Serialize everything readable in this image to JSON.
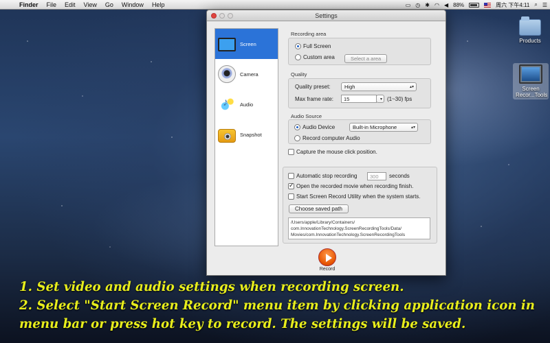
{
  "menubar": {
    "app": "Finder",
    "items": [
      "File",
      "Edit",
      "View",
      "Go",
      "Window",
      "Help"
    ],
    "battery": "88%",
    "clock": "周六 下午4:11"
  },
  "desktop": {
    "products_label": "Products",
    "tool_label": "Screen Recor...Tools"
  },
  "window": {
    "title": "Settings"
  },
  "sidebar": {
    "items": [
      {
        "label": "Screen",
        "icon": "monitor-icon"
      },
      {
        "label": "Camera",
        "icon": "webcam-icon"
      },
      {
        "label": "Audio",
        "icon": "audio-icon"
      },
      {
        "label": "Snapshot",
        "icon": "camera-icon"
      }
    ]
  },
  "recording_area": {
    "title": "Recording area",
    "full_screen": "Full Screen",
    "custom_area": "Custom area",
    "select_button": "Select a area",
    "selected": "Full Screen"
  },
  "quality": {
    "title": "Quality",
    "preset_label": "Quality preset:",
    "preset_value": "High",
    "frame_label": "Max frame rate:",
    "frame_value": "15",
    "frame_range": "(1~30) fps"
  },
  "audio_source": {
    "title": "Audio Source",
    "audio_device_label": "Audio Device",
    "audio_device_value": "Built-in Microphone",
    "record_computer": "Record computer Audio",
    "selected": "Audio Device"
  },
  "capture_mouse": {
    "label": "Capture the mouse click position.",
    "checked": false
  },
  "options": {
    "auto_stop_label": "Automatic stop recording",
    "auto_stop_value": "300",
    "auto_stop_unit": "seconds",
    "auto_stop_checked": false,
    "open_movie_label": "Open the recorded movie when recording finish.",
    "open_movie_checked": true,
    "start_utility_label": "Start Screen Record Utility when the system starts.",
    "start_utility_checked": false,
    "choose_path_button": "Choose saved path",
    "path_lines": [
      "/Users/apple/Library/Containers/",
      "com.InnovationTechnology.ScreenRecordingTools/Data/",
      "Movies/com.InnovationTechnology.ScreenRecordingTools"
    ]
  },
  "record_button": {
    "label": "Record"
  },
  "instructions": [
    "1. Set video and audio settings when recording screen.",
    "2. Select \"Start Screen Record\" menu item by clicking application icon in",
    "menu bar or press hot key to record. The settings will be saved."
  ],
  "colors": {
    "accent": "#2b73d8",
    "instructions": "#e8ee1c",
    "record": "#e65300"
  }
}
